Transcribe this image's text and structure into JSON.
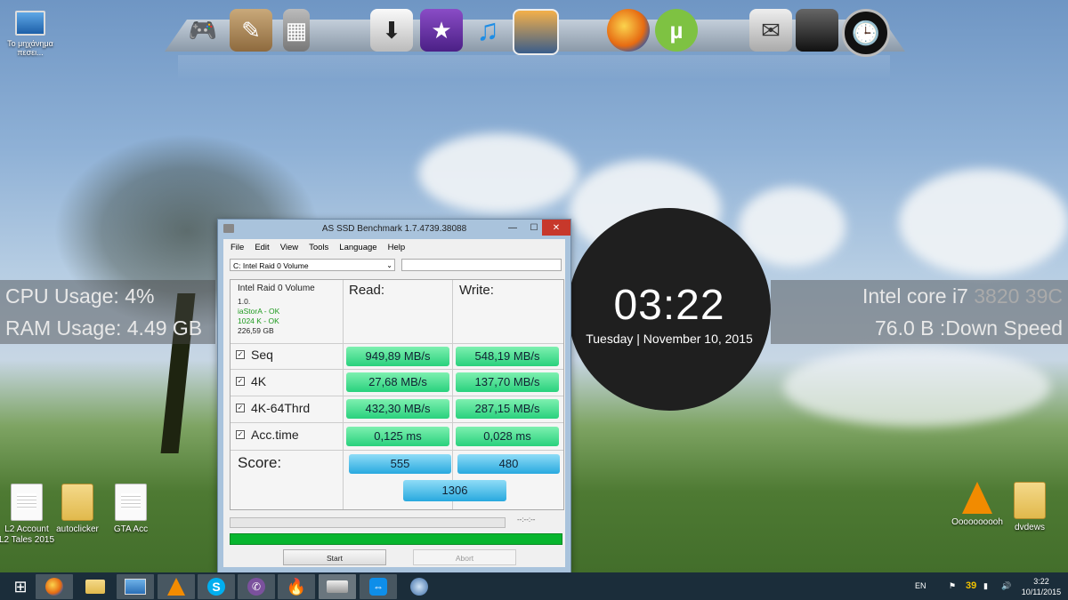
{
  "desktop": {
    "top_left_icon_label": "Το μηχάνημα\nπεσει...",
    "left_icons": [
      {
        "label": "L2 Account\nL2 Tales 2015",
        "kind": "doc"
      },
      {
        "label": "autoclicker",
        "kind": "folder"
      },
      {
        "label": "GTA Acc",
        "kind": "doc"
      }
    ],
    "right_icons": [
      {
        "label": "Oooooooooh",
        "kind": "vlc"
      },
      {
        "label": "dvdews",
        "kind": "folder"
      }
    ]
  },
  "widgets": {
    "cpu_usage": "CPU Usage: 4%",
    "ram_usage": "RAM Usage: 4.49 GB",
    "cpu_name": "Intel core i7",
    "cpu_model_temp": "3820 39C",
    "down_speed": "76.0 B :Down Speed",
    "clock_time": "03:22",
    "clock_date": "Tuesday | November 10, 2015"
  },
  "window": {
    "title": "AS SSD Benchmark 1.7.4739.38088",
    "menu": [
      "File",
      "Edit",
      "View",
      "Tools",
      "Language",
      "Help"
    ],
    "drive_select": "C: Intel Raid 0 Volume",
    "info": {
      "name": "Intel Raid 0 Volume",
      "version": "1.0.",
      "driver": "iaStorA - OK",
      "alignment": "1024 K - OK",
      "size": "226,59 GB"
    },
    "read_header": "Read:",
    "write_header": "Write:",
    "rows": [
      {
        "label": "Seq",
        "read": "949,89 MB/s",
        "write": "548,19 MB/s"
      },
      {
        "label": "4K",
        "read": "27,68 MB/s",
        "write": "137,70 MB/s"
      },
      {
        "label": "4K-64Thrd",
        "read": "432,30 MB/s",
        "write": "287,15 MB/s"
      },
      {
        "label": "Acc.time",
        "read": "0,125 ms",
        "write": "0,028 ms"
      }
    ],
    "score_label": "Score:",
    "score_read": "555",
    "score_write": "480",
    "score_total": "1306",
    "progress_time": "--:--:--",
    "start_button": "Start",
    "abort_button": "Abort"
  },
  "dock": {
    "icons": [
      "gamepad-icon",
      "app-store-icon",
      "calculator-icon",
      "downloads-icon",
      "movies-icon",
      "music-icon",
      "photos-icon",
      "firefox-icon",
      "utorrent-icon",
      "mail-icon",
      "steam-icon",
      "clock-icon"
    ]
  },
  "taskbar": {
    "apps": [
      "firefox-icon",
      "file-explorer-icon",
      "remote-desktop-icon",
      "vlc-icon",
      "skype-icon",
      "viber-icon",
      "flame-icon",
      "drive-benchmark-icon",
      "teamviewer-icon",
      "media-player-icon"
    ],
    "language": "EN",
    "tray_number": "39",
    "time": "3:22",
    "date": "10/11/2015"
  }
}
